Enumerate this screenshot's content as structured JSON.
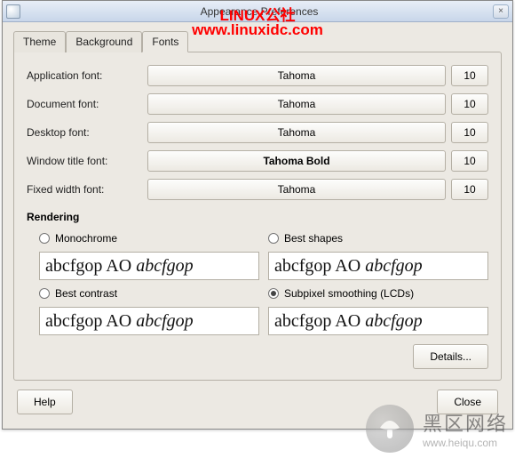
{
  "window": {
    "title": "Appearance Preferences",
    "close_x": "×"
  },
  "watermark": {
    "line1": "LINUX公社",
    "line2": "www.linuxidc.com",
    "brand_cn": "黑区网络",
    "brand_en": "www.heiqu.com"
  },
  "tabs": {
    "theme": "Theme",
    "background": "Background",
    "fonts": "Fonts",
    "active": "fonts"
  },
  "fonts": {
    "rows": [
      {
        "label": "Application font:",
        "name": "Tahoma",
        "size": "10",
        "bold": false
      },
      {
        "label": "Document font:",
        "name": "Tahoma",
        "size": "10",
        "bold": false
      },
      {
        "label": "Desktop font:",
        "name": "Tahoma",
        "size": "10",
        "bold": false
      },
      {
        "label": "Window title font:",
        "name": "Tahoma Bold",
        "size": "10",
        "bold": true
      },
      {
        "label": "Fixed width font:",
        "name": "Tahoma",
        "size": "10",
        "bold": false
      }
    ]
  },
  "rendering": {
    "title": "Rendering",
    "options": {
      "mono": "Monochrome",
      "shapes": "Best shapes",
      "contrast": "Best contrast",
      "subpixel": "Subpixel smoothing (LCDs)"
    },
    "selected": "subpixel",
    "sample_plain": "abcfgop AO ",
    "sample_italic": "abcfgop"
  },
  "buttons": {
    "details": "Details...",
    "help": "Help",
    "close": "Close"
  }
}
